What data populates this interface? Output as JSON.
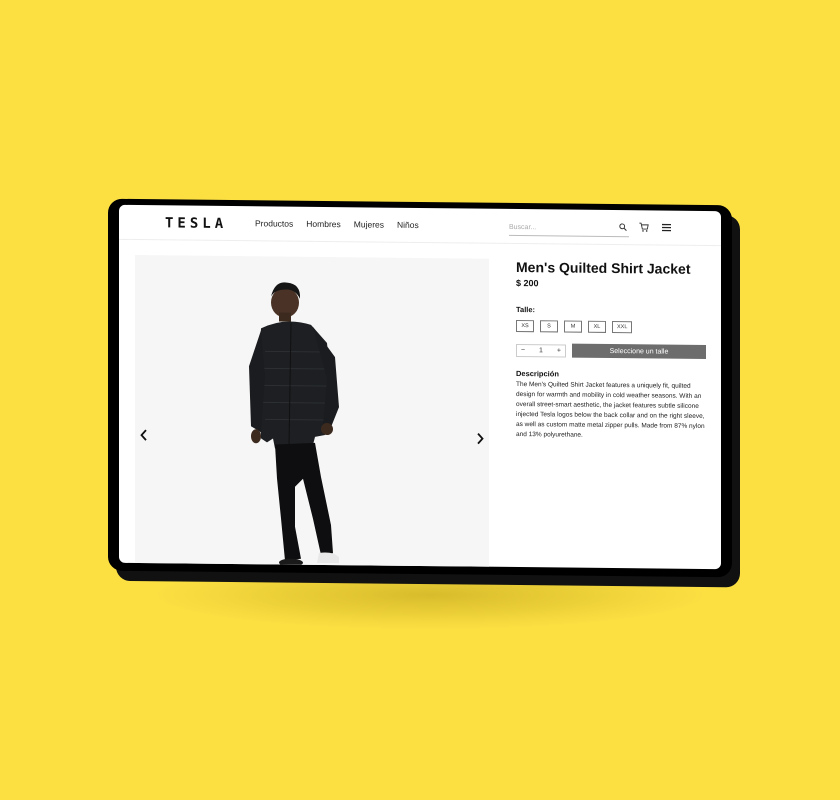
{
  "brand": {
    "logo_text": "TESLA"
  },
  "nav": {
    "items": [
      {
        "label": "Productos"
      },
      {
        "label": "Hombres"
      },
      {
        "label": "Mujeres"
      },
      {
        "label": "Niños"
      }
    ]
  },
  "search": {
    "placeholder": "Buscar..."
  },
  "icons": {
    "search": "search-icon",
    "cart": "cart-icon",
    "menu": "menu-icon",
    "prev": "chevron-left-icon",
    "next": "chevron-right-icon"
  },
  "product": {
    "title": "Men's Quilted Shirt Jacket",
    "price": "$ 200",
    "size_label": "Talle:",
    "sizes": [
      "XS",
      "S",
      "M",
      "XL",
      "XXL"
    ],
    "quantity": "1",
    "qty_minus": "−",
    "qty_plus": "+",
    "cta_label": "Seleccione un talle",
    "description_label": "Descripción",
    "description": "The Men's Quilted Shirt Jacket features a uniquely fit, quilted design for warmth and mobility in cold weather seasons. With an overall street-smart aesthetic, the jacket features subtle silicone injected Tesla logos below the back collar and on the right sleeve, as well as custom matte metal zipper pulls. Made from 87% nylon and 13% polyurethane."
  },
  "colors": {
    "background": "#fce042",
    "cta": "#6d6d6d"
  }
}
